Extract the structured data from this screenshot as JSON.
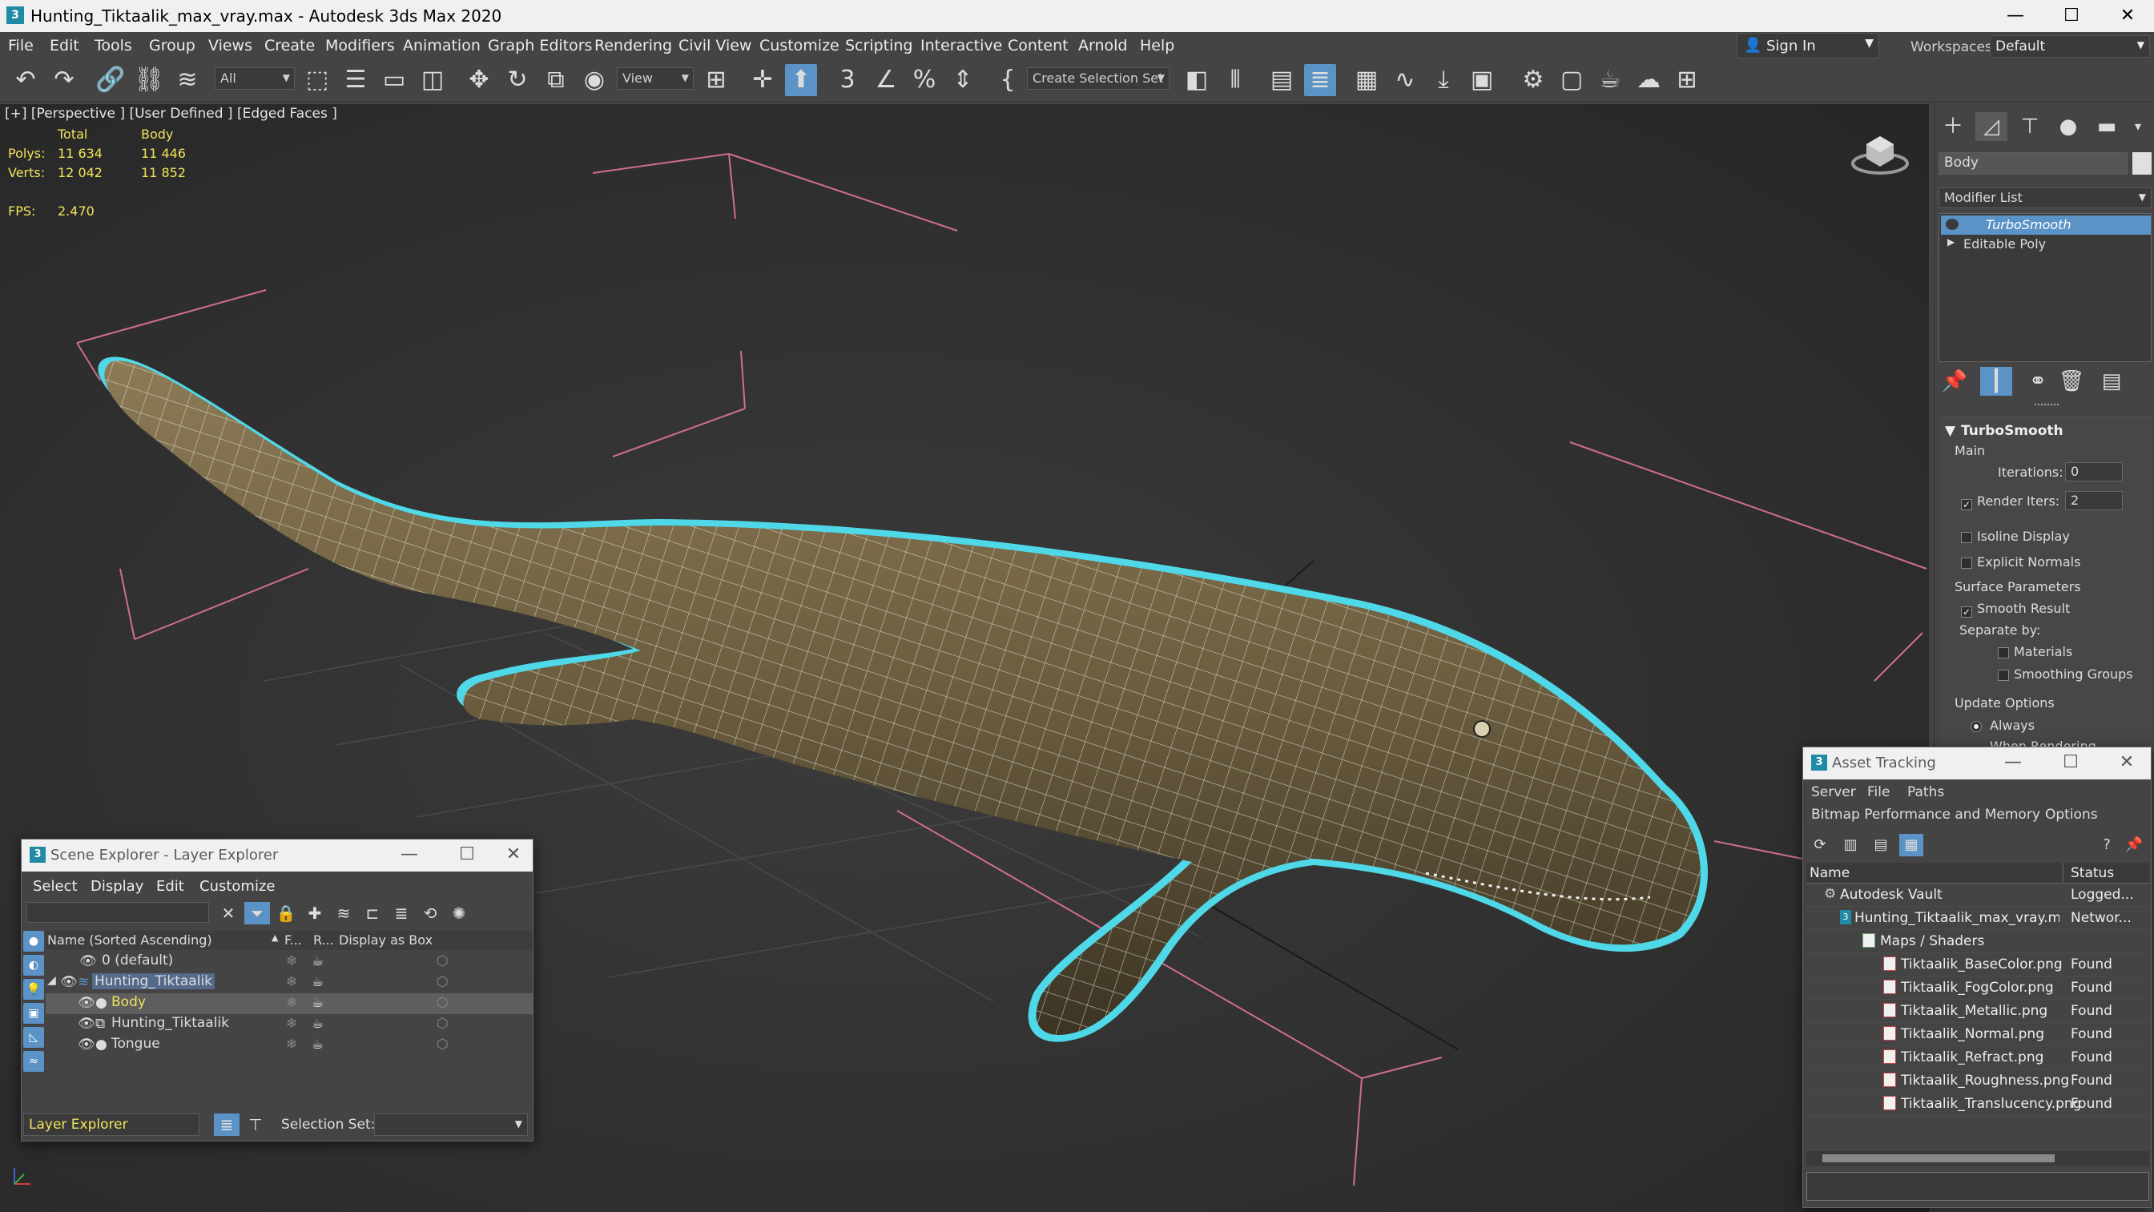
{
  "window": {
    "title": "Hunting_Tiktaalik_max_vray.max - Autodesk 3ds Max 2020",
    "minimize": "—",
    "maximize": "☐",
    "close": "✕"
  },
  "menubar": {
    "items": [
      "File",
      "Edit",
      "Tools",
      "Group",
      "Views",
      "Create",
      "Modifiers",
      "Animation",
      "Graph Editors",
      "Rendering",
      "Civil View",
      "Customize",
      "Scripting",
      "Interactive",
      "Content",
      "Arnold",
      "Help"
    ],
    "sign_in": "Sign In",
    "workspaces_label": "Workspaces:",
    "workspace_value": "Default"
  },
  "toolbar": {
    "filter_value": "All",
    "ref_coord_value": "View",
    "selection_set_placeholder": "Create Selection Set"
  },
  "viewport": {
    "label": "[+] [Perspective ] [User Defined ] [Edged Faces ]",
    "stats": {
      "header_total": "Total",
      "header_body": "Body",
      "polys_label": "Polys:",
      "polys_total": "11 634",
      "polys_body": "11 446",
      "verts_label": "Verts:",
      "verts_total": "12 042",
      "verts_body": "11 852",
      "fps_label": "FPS:",
      "fps_value": "2.470"
    },
    "colors": {
      "selection_outline": "#4fd8e8",
      "grid_pink": "#c86a86",
      "stats_yellow": "#f2e35b"
    }
  },
  "command_panel": {
    "object_name": "Body",
    "modifier_list_label": "Modifier List",
    "stack": [
      {
        "label": "TurboSmooth",
        "selected": true
      },
      {
        "label": "Editable Poly",
        "selected": false
      }
    ],
    "turbosmooth": {
      "title": "TurboSmooth",
      "main_label": "Main",
      "iterations_label": "Iterations:",
      "iterations_value": "0",
      "render_iters_label": "Render Iters:",
      "render_iters_value": "2",
      "render_iters_checked": true,
      "isoline_label": "Isoline Display",
      "explicit_normals_label": "Explicit Normals",
      "surface_params_label": "Surface Parameters",
      "smooth_result_label": "Smooth Result",
      "separate_by_label": "Separate by:",
      "materials_label": "Materials",
      "smoothing_groups_label": "Smoothing Groups",
      "update_options_label": "Update Options",
      "always_label": "Always",
      "when_rendering_label": "When Rendering"
    }
  },
  "scene_explorer": {
    "title": "Scene Explorer - Layer Explorer",
    "menu": [
      "Select",
      "Display",
      "Edit",
      "Customize"
    ],
    "columns": {
      "name": "Name (Sorted Ascending)",
      "freeze": "F...",
      "render": "R...",
      "display_box": "Display as Box"
    },
    "rows": [
      {
        "name": "0 (default)",
        "indent": 0,
        "selected": false
      },
      {
        "name": "Hunting_Tiktaalik",
        "indent": 0,
        "selected": false,
        "highlight": true
      },
      {
        "name": "Body",
        "indent": 1,
        "selected": true
      },
      {
        "name": "Hunting_Tiktaalik",
        "indent": 1,
        "selected": false
      },
      {
        "name": "Tongue",
        "indent": 1,
        "selected": false
      }
    ],
    "bottom_name": "Layer Explorer",
    "selection_set_label": "Selection Set:"
  },
  "asset_tracking": {
    "title": "Asset Tracking",
    "menu_row1": [
      "Server",
      "File",
      "Paths"
    ],
    "menu_row2": [
      "Bitmap Performance and Memory",
      "Options"
    ],
    "columns": {
      "name": "Name",
      "status": "Status"
    },
    "rows": [
      {
        "name": "Autodesk Vault",
        "status": "Logged...",
        "indent": 0
      },
      {
        "name": "Hunting_Tiktaalik_max_vray.max",
        "status": "Networ...",
        "indent": 1
      },
      {
        "name": "Maps / Shaders",
        "status": "",
        "indent": 2
      },
      {
        "name": "Tiktaalik_BaseColor.png",
        "status": "Found",
        "indent": 3
      },
      {
        "name": "Tiktaalik_FogColor.png",
        "status": "Found",
        "indent": 3
      },
      {
        "name": "Tiktaalik_Metallic.png",
        "status": "Found",
        "indent": 3
      },
      {
        "name": "Tiktaalik_Normal.png",
        "status": "Found",
        "indent": 3
      },
      {
        "name": "Tiktaalik_Refract.png",
        "status": "Found",
        "indent": 3
      },
      {
        "name": "Tiktaalik_Roughness.png",
        "status": "Found",
        "indent": 3
      },
      {
        "name": "Tiktaalik_Translucency.png",
        "status": "Found",
        "indent": 3
      }
    ]
  }
}
